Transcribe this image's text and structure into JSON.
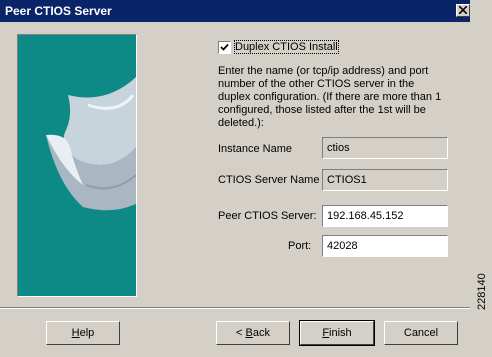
{
  "window": {
    "title": "Peer CTIOS Server",
    "close_icon": "close-icon"
  },
  "options": {
    "duplex_label": "Duplex CTIOS Install",
    "duplex_checked": true
  },
  "description": "Enter the name (or tcp/ip address) and port number of the other CTIOS server in the duplex configuration. (If there are more than 1 configured, those listed after the 1st will be deleted.):",
  "fields": {
    "instance_name": {
      "label": "Instance Name",
      "value": "ctios"
    },
    "ctios_server_name": {
      "label": "CTIOS Server Name",
      "value": "CTIOS1"
    },
    "peer_ctios_server": {
      "label": "Peer CTIOS Server:",
      "value": "192.168.45.152"
    },
    "port": {
      "label": "Port:",
      "value": "42028"
    }
  },
  "buttons": {
    "help": {
      "first": "H",
      "rest": "elp"
    },
    "back": {
      "prefix": "< ",
      "first": "B",
      "rest": "ack"
    },
    "finish": {
      "first": "F",
      "rest": "inish"
    },
    "cancel": "Cancel"
  },
  "figure_number": "228140",
  "colors": {
    "titlebar": "#0a246a",
    "dialog": "#d4d0c8",
    "art_panel": "#0d8a86"
  }
}
